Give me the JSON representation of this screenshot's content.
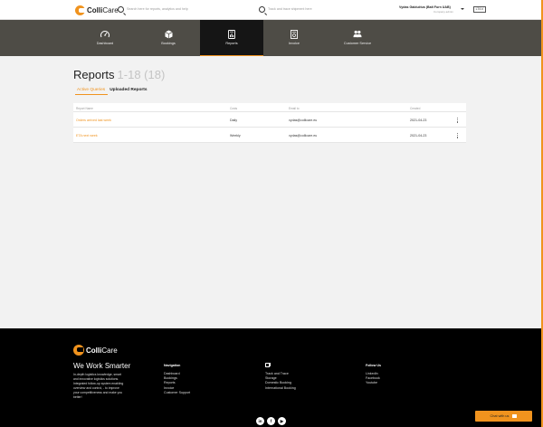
{
  "header": {
    "logo": {
      "bold": "Colli",
      "light": "Care"
    },
    "search": {
      "placeholder": "Search here for reports, analytics and help"
    },
    "track": {
      "placeholder": "Track and trace shipment here"
    },
    "user": {
      "name": "Vydas Gaidučius (Balt Furn UAB)",
      "role": "Company admin"
    },
    "language": "LT/LV"
  },
  "nav": {
    "items": [
      {
        "label": "Dashboard",
        "icon": "speedometer-icon"
      },
      {
        "label": "Bookings",
        "icon": "box-icon"
      },
      {
        "label": "Reports",
        "icon": "report-icon",
        "active": true
      },
      {
        "label": "Invoice",
        "icon": "invoice-icon"
      },
      {
        "label": "Customer Service",
        "icon": "people-icon"
      }
    ]
  },
  "page": {
    "title": "Reports",
    "count": "1-18 (18)",
    "tabs": [
      {
        "label": "Active Queries",
        "active": true
      },
      {
        "label": "Uploaded Reports",
        "active": false
      }
    ]
  },
  "table": {
    "headers": [
      "Report Name",
      "Costs",
      "Email to",
      "Created"
    ],
    "rows": [
      {
        "name": "Orders arrived last week",
        "cost": "Daily",
        "email": "vydas@collicare.eu",
        "created": "2021-04-23"
      },
      {
        "name": "ETA next week",
        "cost": "Weekly",
        "email": "vydas@collicare.eu",
        "created": "2021-04-23"
      }
    ]
  },
  "footer": {
    "logo": {
      "bold": "Colli",
      "light": "Care"
    },
    "tagline": "We Work Smarter",
    "description": [
      "In-depth logistics knowledge, smart",
      "and innovative logistics solutions.",
      "Integrated follow-up system enabling",
      "overview and control, - to improve",
      "your competitiveness and make you",
      "better!"
    ],
    "navigation": {
      "heading": "Navigation",
      "links": [
        "Dashboard",
        "Bookings",
        "Reports",
        "Invoice",
        "Customer Support"
      ]
    },
    "services": {
      "links": [
        "Track and Trace",
        "Storage",
        "Domestic Booking",
        "International Booking"
      ]
    },
    "follow": {
      "heading": "Follow Us",
      "links": [
        "LinkedIn",
        "Facebook",
        "Youtube"
      ]
    },
    "social": [
      {
        "glyph": "in",
        "icon": "linkedin-icon"
      },
      {
        "glyph": "f",
        "icon": "facebook-icon"
      },
      {
        "glyph": "▶",
        "icon": "youtube-icon"
      }
    ]
  },
  "chat": {
    "label": "Chat with us"
  },
  "colors": {
    "accent": "#f0931e",
    "nav_bg": "#4e4c46",
    "nav_active": "#151515",
    "footer_bg": "#000000"
  }
}
